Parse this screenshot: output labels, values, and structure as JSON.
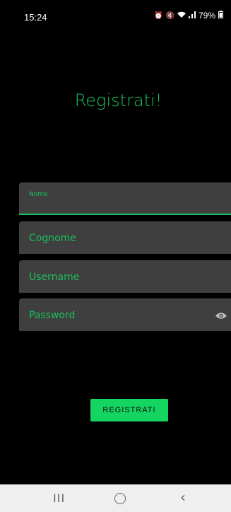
{
  "status_bar": {
    "time": "15:24",
    "battery": "79%"
  },
  "title": "Registrati!",
  "form": {
    "nome_label": "Nome",
    "cognome_placeholder": "Cognome",
    "username_placeholder": "Username",
    "password_placeholder": "Password"
  },
  "register_button": "REGISTRATI",
  "nav": {
    "recents": "III",
    "back": "‹"
  },
  "colors": {
    "accent": "#19c15a",
    "button": "#14d561",
    "field_bg": "#3f3f3f",
    "background": "#000000"
  },
  "icons": [
    "alarm-icon",
    "mute-icon",
    "wifi-icon",
    "signal-icon",
    "battery-icon",
    "visibility-eye-icon",
    "recents-icon",
    "home-icon",
    "back-icon"
  ]
}
